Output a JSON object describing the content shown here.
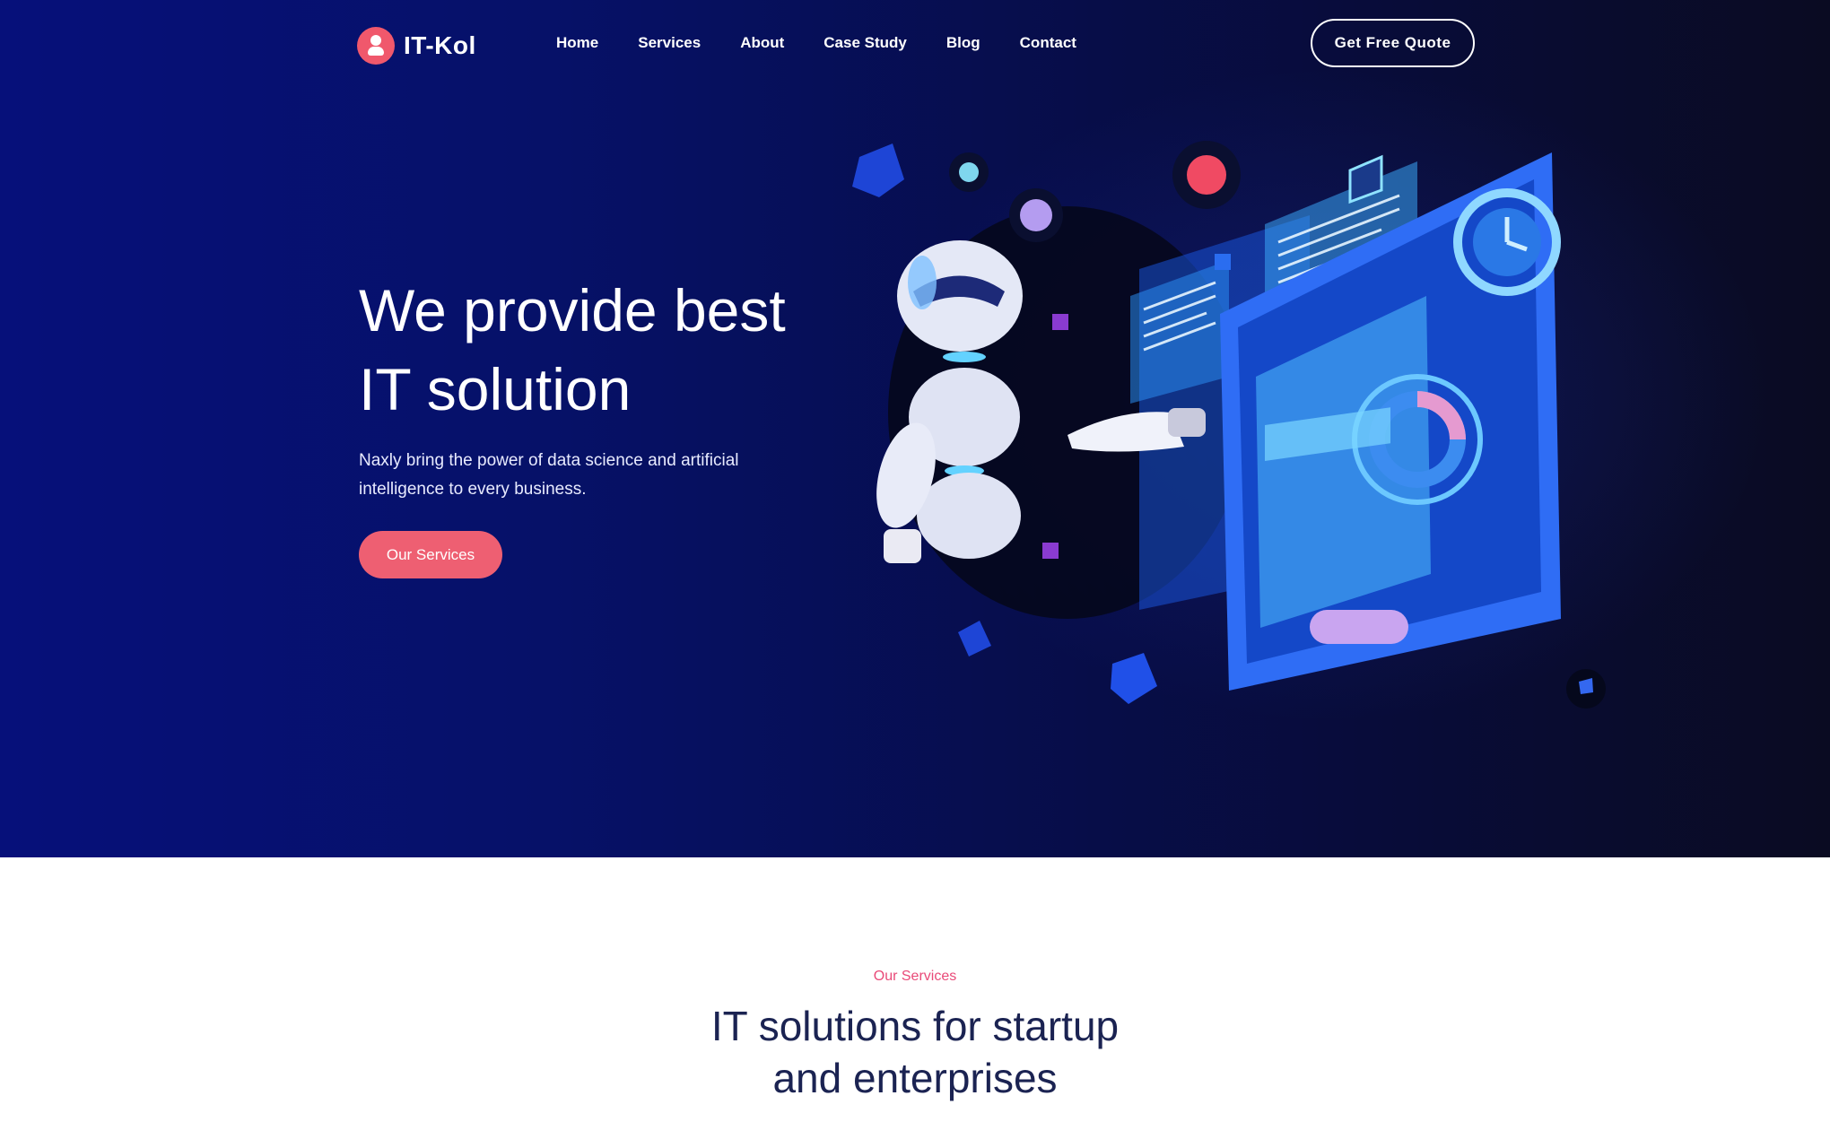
{
  "brand": {
    "name": "IT-Kol",
    "accent": "#f0586c"
  },
  "nav": {
    "items": [
      "Home",
      "Services",
      "About",
      "Case Study",
      "Blog",
      "Contact"
    ],
    "cta": "Get Free Quote"
  },
  "hero": {
    "title_line1": "We provide best",
    "title_line2": "IT solution",
    "subtitle_line1": "Naxly bring the power of data science and artificial",
    "subtitle_line2": "intelligence to every business.",
    "button": "Our Services",
    "background": "#061168"
  },
  "services_section": {
    "tag": "Our Services",
    "title_line1": "IT solutions for startup",
    "title_line2": "and enterprises"
  },
  "icons": [
    "logo-mark-icon",
    "robot-illustration",
    "dashboard-screen-illustration"
  ]
}
